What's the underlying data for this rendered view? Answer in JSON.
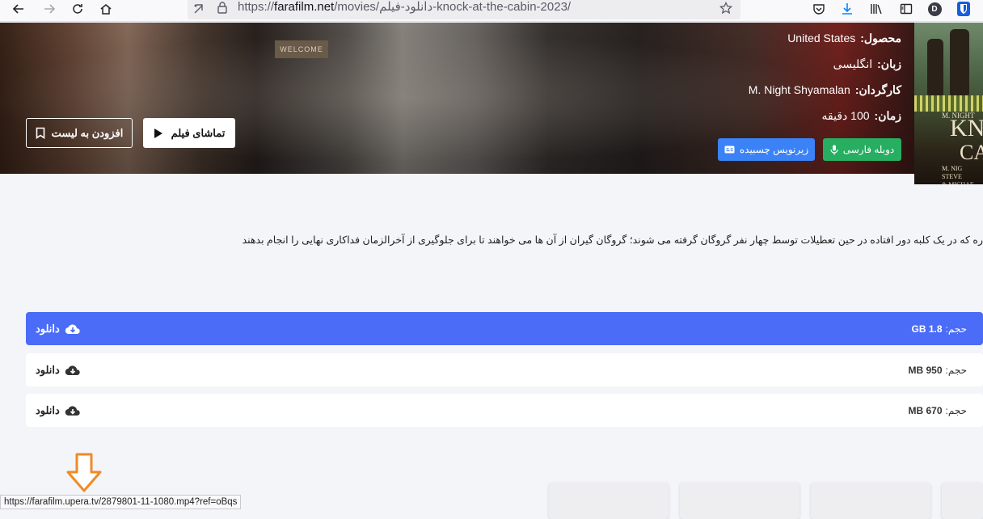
{
  "browser": {
    "url_prefix": "https://",
    "url_domain": "farafilm.net",
    "url_path": "/movies/دانلود-فیلم-knock-at-the-cabin-2023/",
    "avatar_letter": "D",
    "status_url": "https://farafilm.upera.tv/2879801-11-1080.mp4?ref=oBqs"
  },
  "hero": {
    "sign_text": "WELCOME",
    "info": [
      {
        "label": "محصول:",
        "value": "United States"
      },
      {
        "label": "زبان:",
        "value": "انگلیسی"
      },
      {
        "label": "کارگردان:",
        "value": "M. Night Shyamalan"
      },
      {
        "label": "زمان:",
        "value": "100 دقیقه"
      }
    ],
    "watch_label": "تماشای فیلم",
    "add_list_label": "افزودن به لیست",
    "dub_label": "دوبله فارسی",
    "sub_label": "زیرنویس چسبیده"
  },
  "poster": {
    "line1": "M. NIGHT",
    "line2": "KNOCK",
    "line3": "CA",
    "credits": "M. NIG\nSTEVE\n& MICHAE"
  },
  "description": "ره که در یک کلبه دور افتاده در حین تعطیلات توسط چهار نفر گروگان گرفته می شوند؛ گروگان گیران از آن ها می خواهند تا برای جلوگیری از آخرالزمان فداکاری نهایی را انجام بدهند",
  "downloads": [
    {
      "size_label": "حجم:",
      "size": "1.8 GB",
      "button": "دانلود",
      "active": true
    },
    {
      "size_label": "حجم:",
      "size": "950 MB",
      "button": "دانلود",
      "active": false
    },
    {
      "size_label": "حجم:",
      "size": "670 MB",
      "button": "دانلود",
      "active": false
    }
  ],
  "colors": {
    "primary": "#4a6cf7",
    "dub_green": "#27ae60",
    "sub_blue": "#3b82f6",
    "annotation_arrow": "#f08a24"
  }
}
